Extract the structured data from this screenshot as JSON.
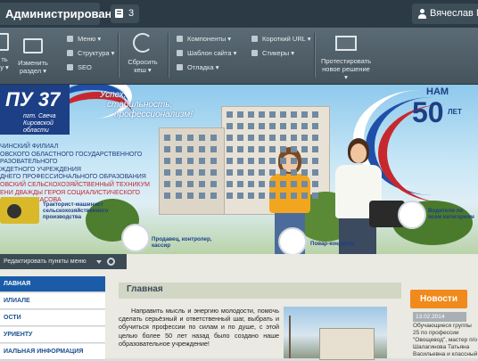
{
  "admin_bar": {
    "title": "Администрирование",
    "notifications_count": "3",
    "user_name": "Вячеслав Масл"
  },
  "toolbar": {
    "create_label": "ть",
    "create_sub": "у ▾",
    "change_section_label": "Изменить",
    "change_section_sub": "раздел ▾",
    "menu_label": "Меню",
    "structure_label": "Структура",
    "seo_label": "SEO",
    "reset_cache_label": "Сбросить",
    "reset_cache_sub": "кеш ▾",
    "components_label": "Компоненты",
    "site_template_label": "Шаблон сайта",
    "debug_label": "Отладка",
    "short_url_label": "Короткий URL",
    "stickers_label": "Стикеры",
    "test_label": "Протестировать",
    "test_sub": "новое решение ▾"
  },
  "banner": {
    "logo_main": "ПУ 37",
    "logo_sub_1": "пгт. Свеча",
    "logo_sub_2": "Кировской области",
    "slogan_1": "Успех,",
    "slogan_2": "стабильность,",
    "slogan_3": "профессионализм!",
    "years_top": "НАМ",
    "years_num": "50",
    "years_unit": "ЛЕТ",
    "school_lines": [
      "ЧИНСКИЙ ФИЛИАЛ",
      "ОВСКОГО ОБЛАСТНОГО ГОСУДАРСТВЕННОГО",
      "РАЗОВАТЕЛЬНОГО",
      "ЖДЕТНОГО УЧРЕЖДЕНИЯ",
      "ДНЕГО ПРОФЕССИОНАЛЬНОГО ОБРАЗОВАНИЯ",
      "ОВСКИЙ СЕЛЬСКОХОЗЯЙСТВЕННЫЙ ТЕХНИКУМ",
      "ЕНИ ДВАЖДЫ ГЕРОЯ СОЦИАЛИСТИЧЕСКОГО",
      "ДА А.Д. ЧЕРКАСОВА"
    ],
    "label_tractor": "Тракторист-машинист сельскохозяйственного производства",
    "label_seller": "Продавец, контролер, кассир",
    "label_cook": "Повар-кондитер",
    "label_drivers": "Водители по всем категориям"
  },
  "edit_panel": {
    "label": "Редактировать пункты меню"
  },
  "menu": {
    "items": [
      "ЛАВНАЯ",
      "ИЛИАЛЕ",
      "ОСТИ",
      "УРИЕНТУ",
      "ИАЛЬНАЯ ИНФОРМАЦИЯ"
    ]
  },
  "main": {
    "title": "Главная",
    "text": "Направить мысль и энергию молодости, помочь сделать серьёзный и ответственный шаг, выбрать и обучиться профессии по силам и по душе, с этой целью более 50 лет назад было создано наше образовательное учреждение!"
  },
  "news": {
    "title": "Новости",
    "date": "13.02.2014",
    "text": "Обучающиеся группы 25 по профессии \"Овощевод\", мастер п/о Шалагинова Татьяна Васильевна и классный"
  },
  "colors": {
    "admin_bar": "#2b3a45",
    "panel": "#4f5e68",
    "site_blue": "#1c3f86",
    "menu_active": "#1a5ca8",
    "news_orange": "#f08a1c"
  }
}
